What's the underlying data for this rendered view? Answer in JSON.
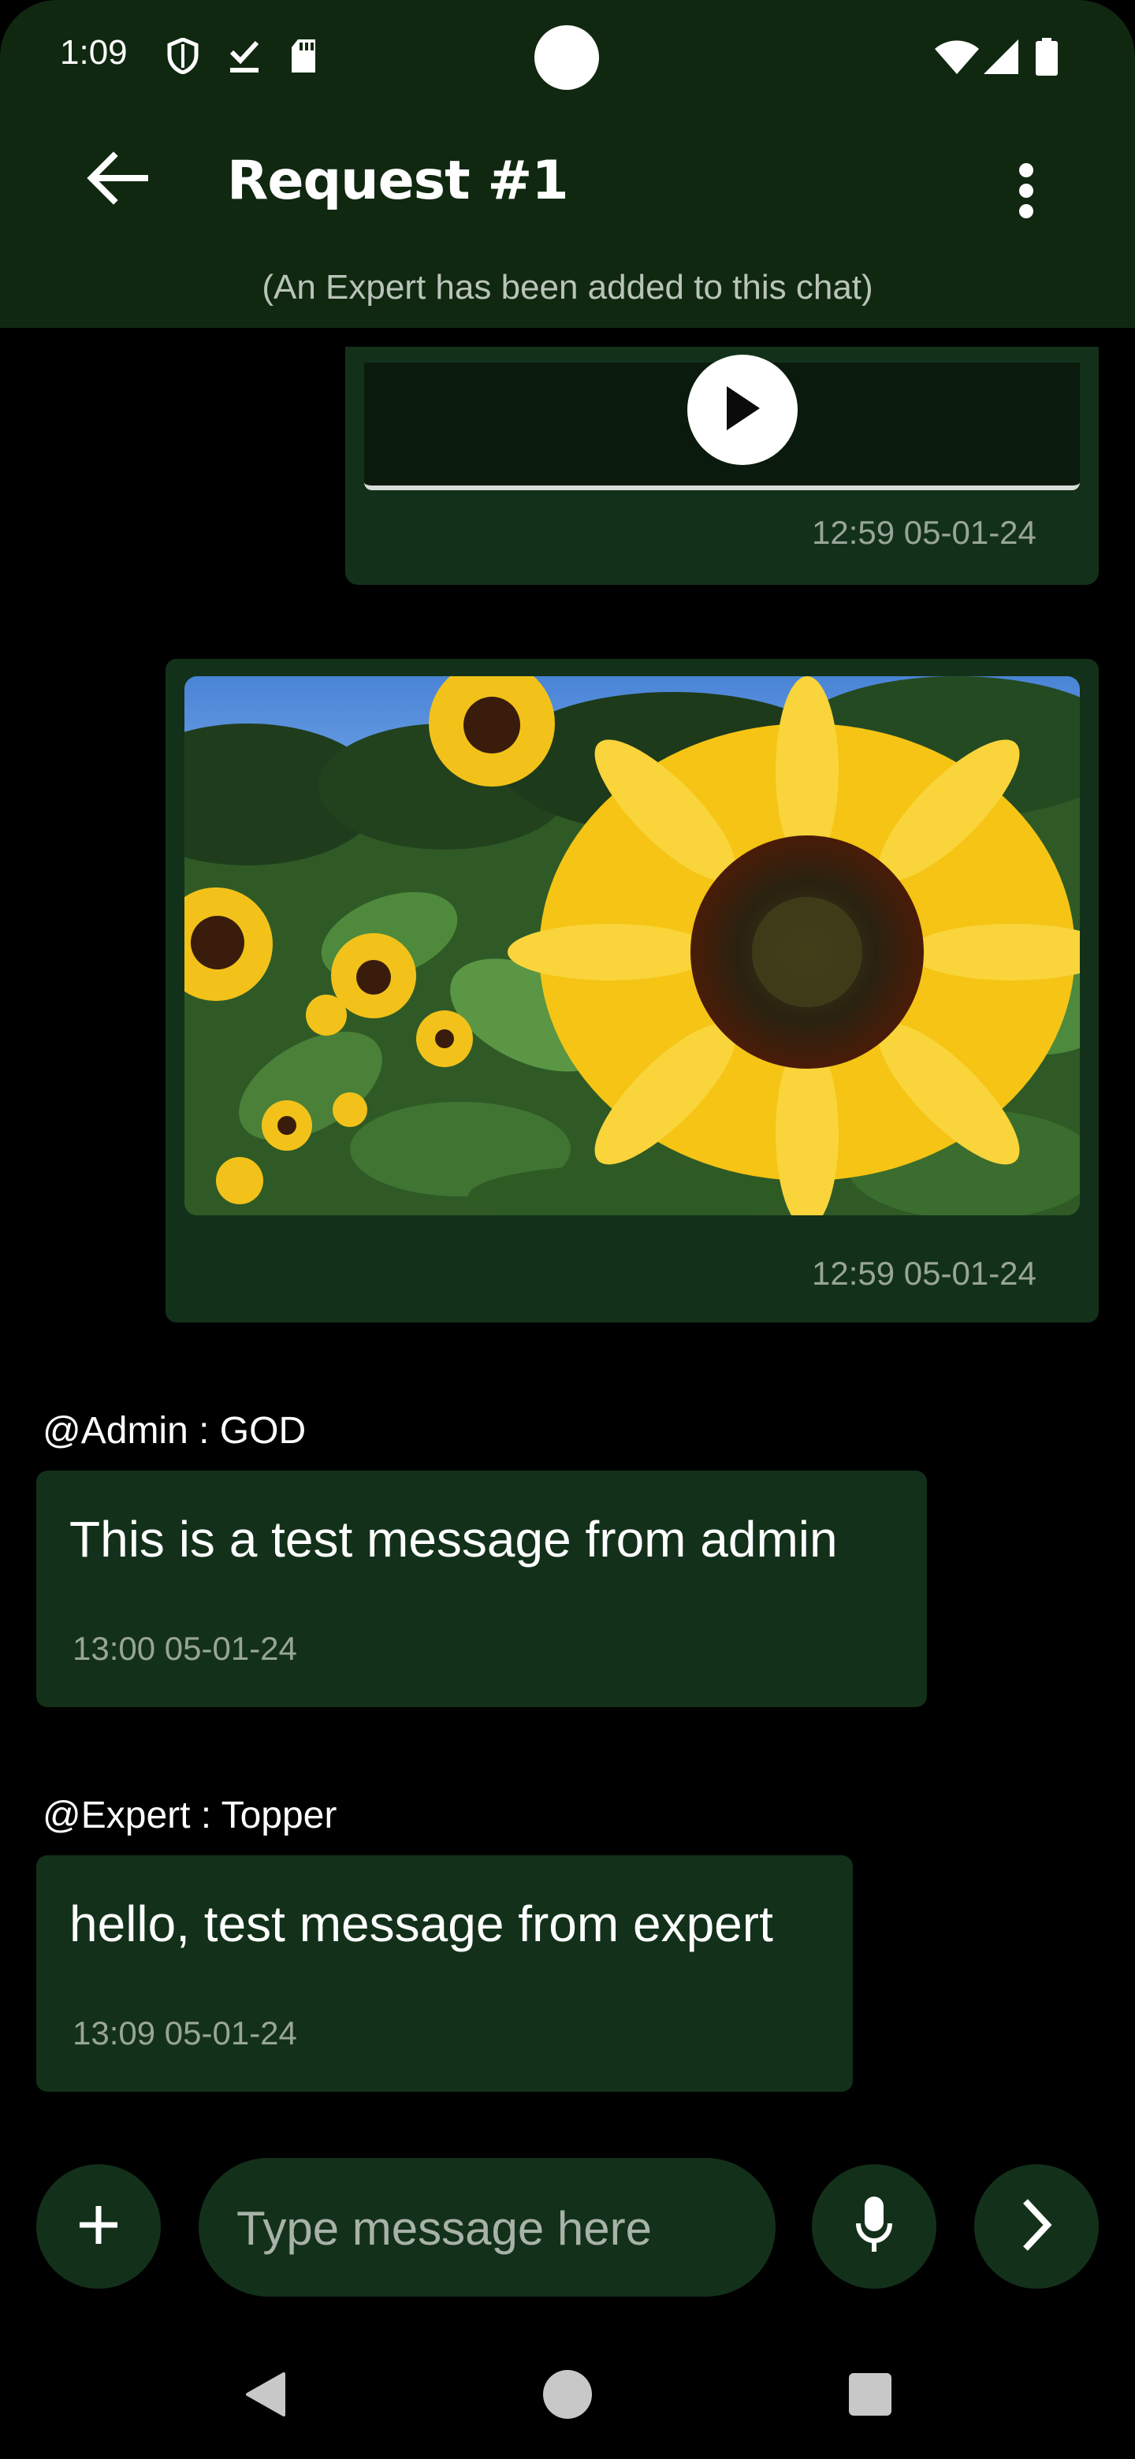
{
  "status_bar": {
    "time": "1:09",
    "icons": [
      "shield-icon",
      "check-download-icon",
      "sd-card-icon",
      "wifi-icon",
      "signal-icon",
      "battery-icon"
    ]
  },
  "header": {
    "title": "Request #1",
    "subtitle": "(An Expert has been added to this chat)",
    "back_icon": "arrow-back-icon",
    "menu_icon": "more-vertical-icon",
    "background": "#102810"
  },
  "messages": [
    {
      "type": "video",
      "timestamp": "12:59 05-01-24",
      "play_icon": "play-icon"
    },
    {
      "type": "image",
      "image": "sunflower-photo",
      "timestamp": "12:59 05-01-24"
    },
    {
      "type": "text",
      "sender": "@Admin : GOD",
      "text": "This is a test message from admin",
      "timestamp": "13:00 05-01-24"
    },
    {
      "type": "text",
      "sender": "@Expert : Topper",
      "text": "hello, test message from expert",
      "timestamp": "13:09 05-01-24"
    }
  ],
  "composer": {
    "placeholder": "Type message here",
    "value": "",
    "add_icon": "plus-icon",
    "mic_icon": "mic-icon",
    "send_icon": "chevron-right-icon"
  },
  "colors": {
    "bubble": "#13311a",
    "timestamp": "#98a598",
    "background": "#000000"
  },
  "nav_bar": {
    "icons": [
      "back-triangle-icon",
      "home-circle-icon",
      "recents-square-icon"
    ]
  }
}
